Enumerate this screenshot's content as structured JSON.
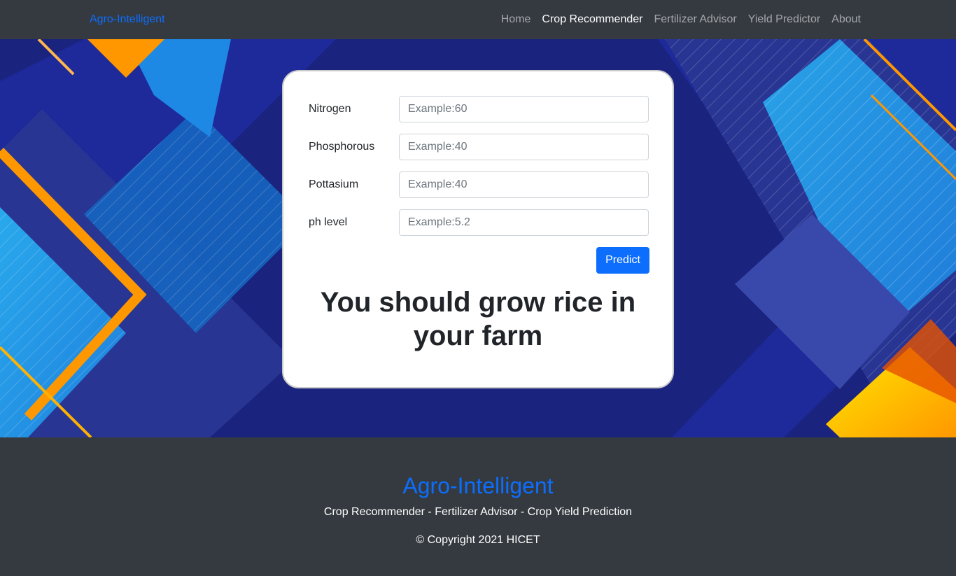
{
  "navbar": {
    "brand": "Agro-Intelligent",
    "links": [
      {
        "label": "Home",
        "active": false
      },
      {
        "label": "Crop Recommender",
        "active": true
      },
      {
        "label": "Fertilizer Advisor",
        "active": false
      },
      {
        "label": "Yield Predictor",
        "active": false
      },
      {
        "label": "About",
        "active": false
      }
    ]
  },
  "form": {
    "fields": [
      {
        "label": "Nitrogen",
        "placeholder": "Example:60",
        "value": ""
      },
      {
        "label": "Phosphorous",
        "placeholder": "Example:40",
        "value": ""
      },
      {
        "label": "Pottasium",
        "placeholder": "Example:40",
        "value": ""
      },
      {
        "label": "ph level",
        "placeholder": "Example:5.2",
        "value": ""
      }
    ],
    "submit_label": "Predict",
    "result": "You should grow rice in your farm"
  },
  "footer": {
    "title": "Agro-Intelligent",
    "tagline": "Crop Recommender - Fertilizer Advisor - Crop Yield Prediction",
    "copyright": "© Copyright 2021 HICET"
  },
  "colors": {
    "navbar_bg": "#343a40",
    "brand": "#0d6efd",
    "button": "#0d6efd",
    "hero_base": "#1a237e"
  }
}
